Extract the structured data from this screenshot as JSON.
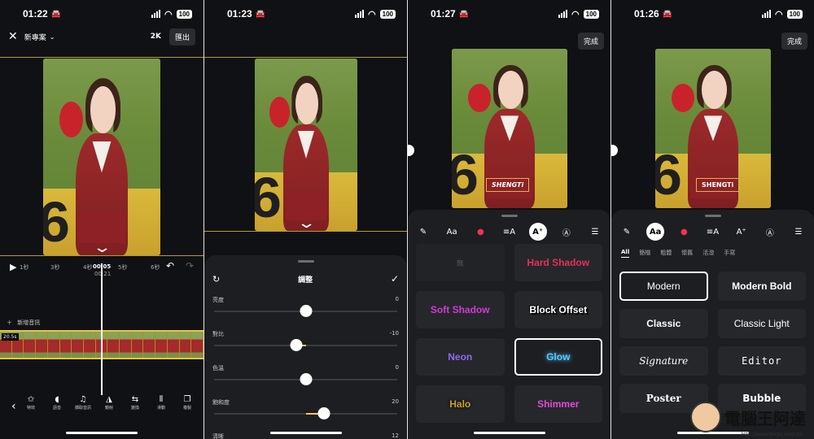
{
  "status": [
    {
      "time": "01:22",
      "battery": "100"
    },
    {
      "time": "01:23",
      "battery": "100"
    },
    {
      "time": "01:27",
      "battery": "100"
    },
    {
      "time": "01:26",
      "battery": "100"
    }
  ],
  "p1": {
    "project_title": "新專案",
    "resolution": "2K",
    "export_label": "匯出",
    "ruler": [
      "1秒",
      "3秒",
      "4秒",
      "00:05",
      "5秒",
      "6秒"
    ],
    "current_time": "00:21",
    "add_audio": "新增音訊",
    "clip_badge": "20.5s",
    "tools": [
      "特效",
      "語音",
      "擷取音訊",
      "鏡射",
      "變換",
      "滑動",
      "複製"
    ]
  },
  "p2": {
    "title": "調整",
    "sliders": [
      {
        "label": "亮度",
        "value": "0",
        "level": 0.5
      },
      {
        "label": "對比",
        "value": "-10",
        "level": 0.45
      },
      {
        "label": "色溫",
        "value": "0",
        "level": 0.5
      },
      {
        "label": "飽和度",
        "value": "20",
        "level": 0.6
      },
      {
        "label": "清晰",
        "value": "12",
        "level": 0.56
      }
    ]
  },
  "p3": {
    "done_label": "完成",
    "caption_text": "SHENGTi",
    "styles": [
      "無",
      "Hard Shadow",
      "Soft Shadow",
      "Block Offset",
      "Neon",
      "Glow",
      "Halo",
      "Shimmer"
    ],
    "style_colors": [
      "#555555",
      "#e2315a",
      "#d23ad8",
      "#ffffff",
      "#8d6af2",
      "#56c8ff",
      "#caa02e",
      "#e04bd8"
    ]
  },
  "p4": {
    "done_label": "完成",
    "caption_text": "SHENGTi",
    "font_tabs": [
      "All",
      "簡楷",
      "粗體",
      "懷舊",
      "活潑",
      "手寫"
    ],
    "fonts": [
      "Modern",
      "Modern Bold",
      "Classic",
      "Classic Light",
      "Signature",
      "Editor",
      "Poster",
      "Bubble"
    ]
  },
  "watermark": {
    "brand": "電腦王阿達",
    "url": "http://www.kocpc.com.tw"
  }
}
